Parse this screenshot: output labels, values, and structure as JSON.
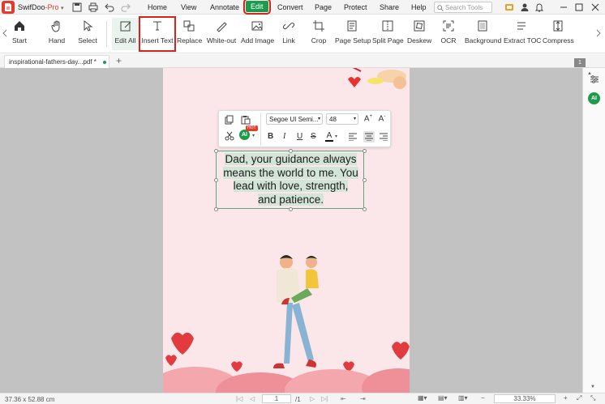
{
  "app": {
    "name": "SwifDoo",
    "name_suffix": "-Pro"
  },
  "menu": {
    "items": [
      "Home",
      "View",
      "Annotate",
      "Edit",
      "Convert",
      "Page",
      "Protect",
      "Share",
      "Help"
    ],
    "active": "Edit"
  },
  "search": {
    "placeholder": "Search Tools"
  },
  "ribbon": {
    "tools": [
      "Start",
      "Hand",
      "Select",
      "Edit All",
      "Insert Text",
      "Replace",
      "White-out",
      "Add Image",
      "Link",
      "Crop",
      "Page Setup",
      "Split Page",
      "Deskew",
      "OCR",
      "Background",
      "Extract TOC",
      "Compress"
    ]
  },
  "tab": {
    "title": "inspirational-fathers-day...pdf *",
    "add": "+"
  },
  "format": {
    "font": "Segoe UI Semi...",
    "size": "48",
    "ai_badge": "AI",
    "hot_badge": "HOT"
  },
  "document": {
    "lines": [
      "Dad, your guidance always",
      "means the world to me. You",
      "lead with love, strength,",
      "and patience."
    ]
  },
  "right_panel": {
    "page_badge": "1",
    "ai_label": "AI"
  },
  "status": {
    "dimensions": "37.36 x 52.88 cm",
    "page_current": "1",
    "page_total": "/1",
    "zoom": "33.33%"
  },
  "colors": {
    "accent": "#1d9a4c",
    "brand": "#e23c2f",
    "highlight_outline": "#d9221c",
    "page_bg": "#fbe7ea"
  }
}
